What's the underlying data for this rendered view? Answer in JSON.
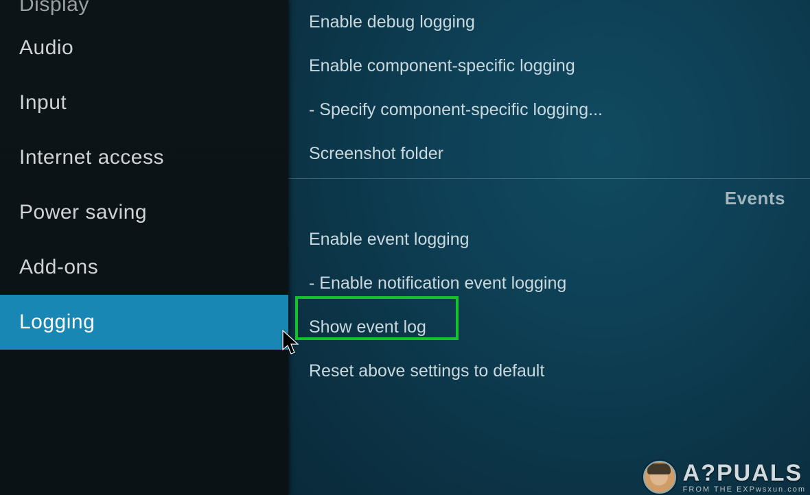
{
  "sidebar": {
    "items": [
      {
        "label": "Display",
        "state": "dim first"
      },
      {
        "label": "Audio",
        "state": ""
      },
      {
        "label": "Input",
        "state": ""
      },
      {
        "label": "Internet access",
        "state": ""
      },
      {
        "label": "Power saving",
        "state": ""
      },
      {
        "label": "Add-ons",
        "state": ""
      },
      {
        "label": "Logging",
        "state": "selected"
      }
    ]
  },
  "content": {
    "group1": [
      "Enable debug logging",
      "Enable component-specific logging",
      "- Specify component-specific logging...",
      "Screenshot folder"
    ],
    "sectionHeader": "Events",
    "group2": [
      "Enable event logging",
      "- Enable notification event logging",
      "Show event log",
      "Reset above settings to default"
    ]
  },
  "watermark": {
    "brand": "A?PUALS",
    "sub": "FROM THE EXPwsxun.com"
  }
}
